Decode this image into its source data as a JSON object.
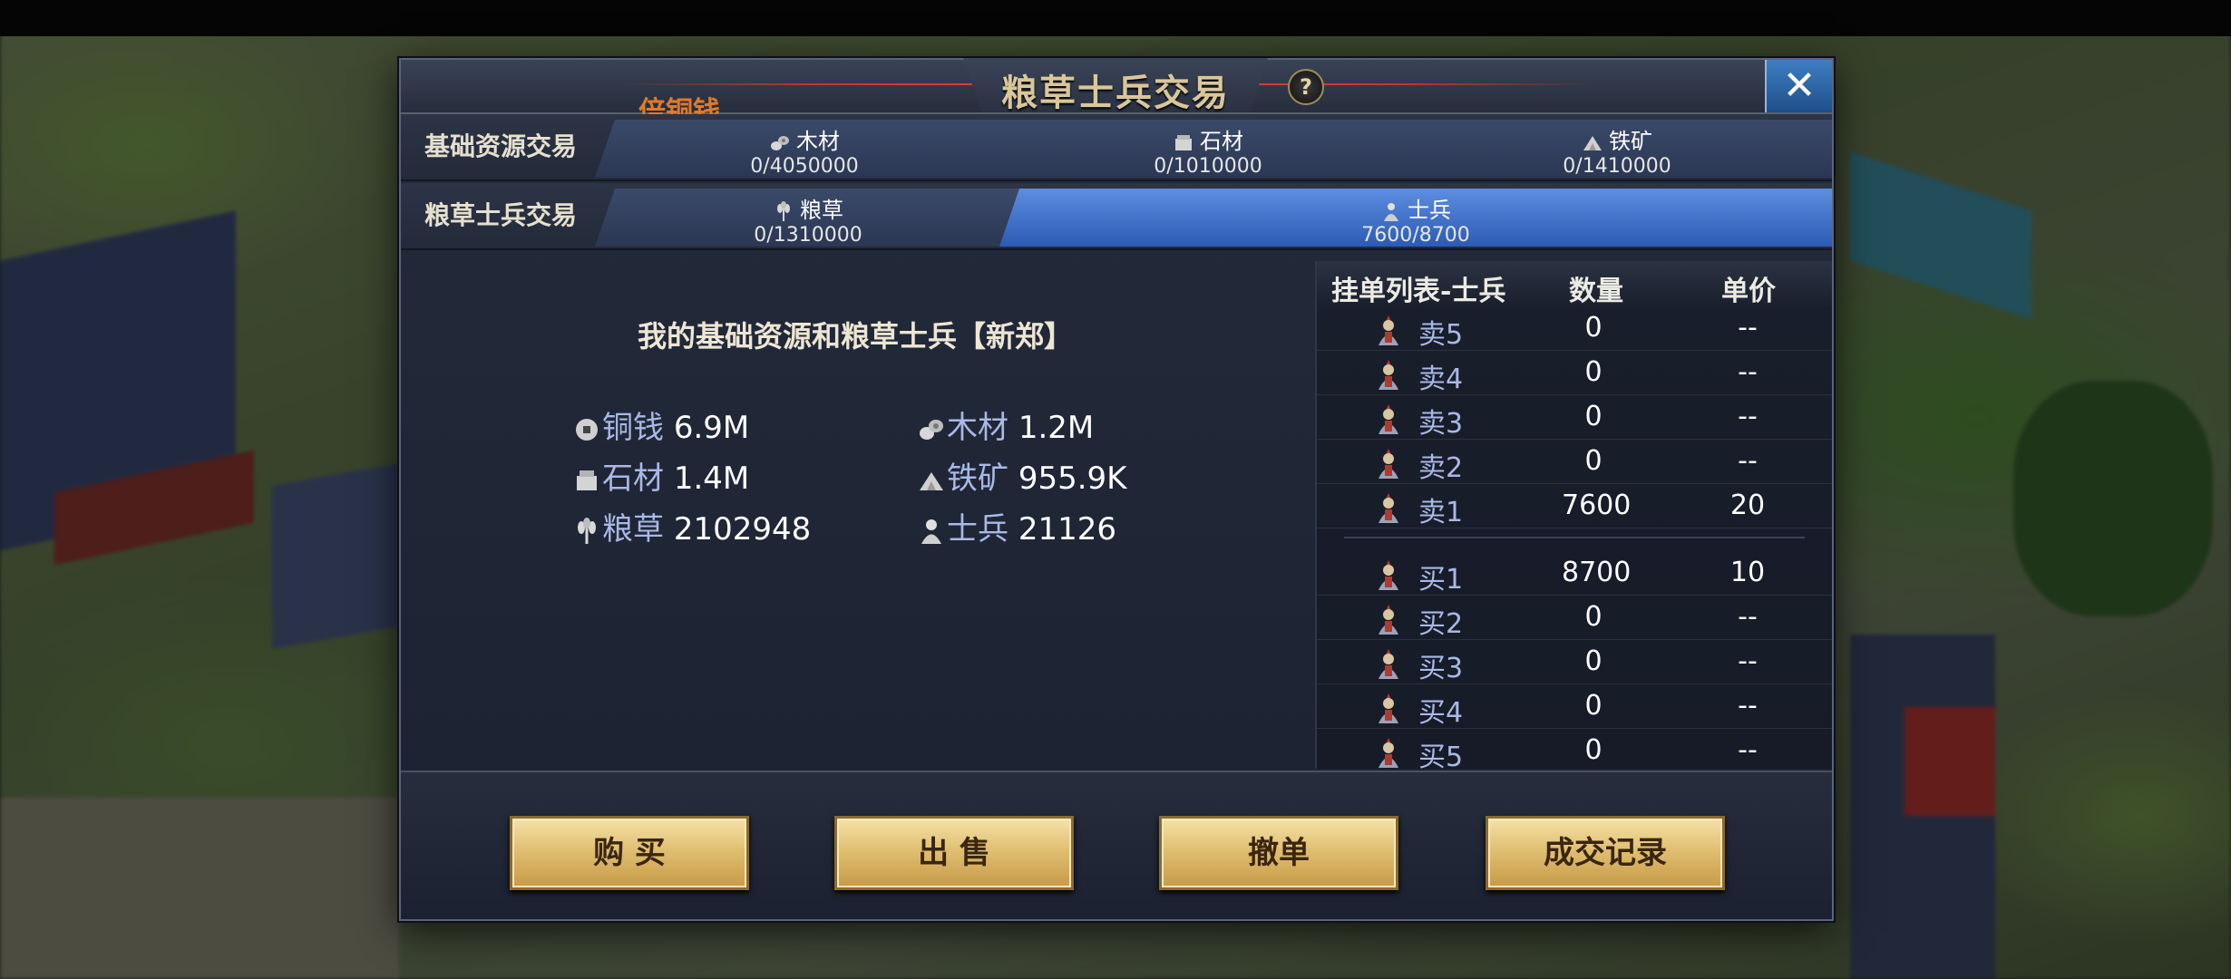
{
  "panel": {
    "title": "粮草士兵交易",
    "subtitle": "倍铜钱",
    "help_label": "?",
    "close_label": "✕"
  },
  "rows": {
    "basic_label": "基础资源交易",
    "grain_label": "粮草士兵交易"
  },
  "tabs": {
    "wood": {
      "name": "木材",
      "value": "0/4050000",
      "icon": "wood-icon"
    },
    "stone": {
      "name": "石材",
      "value": "0/1010000",
      "icon": "stone-icon"
    },
    "iron": {
      "name": "铁矿",
      "value": "0/1410000",
      "icon": "iron-icon"
    },
    "grain": {
      "name": "粮草",
      "value": "0/1310000",
      "icon": "grain-icon"
    },
    "soldier": {
      "name": "士兵",
      "value": "7600/8700",
      "icon": "soldier-icon",
      "active": true
    }
  },
  "my_resources": {
    "title": "我的基础资源和粮草士兵【新郑】",
    "copper": {
      "name": "铜钱",
      "value": "6.9M"
    },
    "wood": {
      "name": "木材",
      "value": "1.2M"
    },
    "stone": {
      "name": "石材",
      "value": "1.4M"
    },
    "iron": {
      "name": "铁矿",
      "value": "955.9K"
    },
    "grain": {
      "name": "粮草",
      "value": "2102948"
    },
    "soldier": {
      "name": "士兵",
      "value": "21126"
    }
  },
  "order_book": {
    "headers": {
      "list": "挂单列表-士兵",
      "qty": "数量",
      "price": "单价"
    },
    "sell": [
      {
        "label": "卖5",
        "qty": "0",
        "price": "--"
      },
      {
        "label": "卖4",
        "qty": "0",
        "price": "--"
      },
      {
        "label": "卖3",
        "qty": "0",
        "price": "--"
      },
      {
        "label": "卖2",
        "qty": "0",
        "price": "--"
      },
      {
        "label": "卖1",
        "qty": "7600",
        "price": "20"
      }
    ],
    "buy": [
      {
        "label": "买1",
        "qty": "8700",
        "price": "10"
      },
      {
        "label": "买2",
        "qty": "0",
        "price": "--"
      },
      {
        "label": "买3",
        "qty": "0",
        "price": "--"
      },
      {
        "label": "买4",
        "qty": "0",
        "price": "--"
      },
      {
        "label": "买5",
        "qty": "0",
        "price": "--"
      }
    ]
  },
  "buttons": {
    "buy": "购 买",
    "sell": "出 售",
    "cancel": "撤单",
    "history": "成交记录"
  },
  "colors": {
    "accent": "#3d7fc4",
    "active_tab": "#5d8ee0",
    "button_gold": "#e0bf72",
    "subtitle": "#e07a2a"
  }
}
